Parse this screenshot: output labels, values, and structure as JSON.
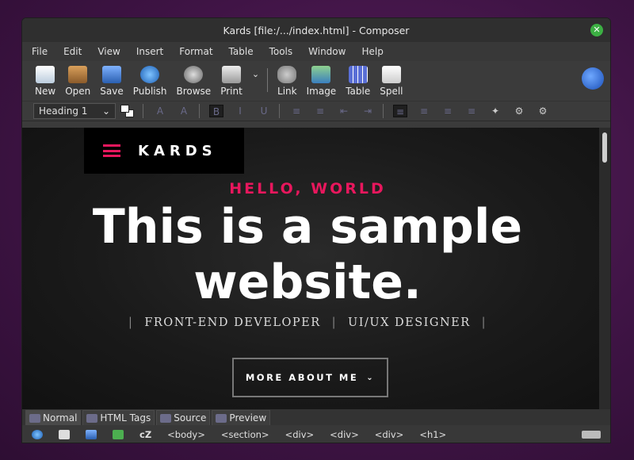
{
  "window": {
    "title": "Kards [file:/.../index.html] - Composer"
  },
  "menu": [
    "File",
    "Edit",
    "View",
    "Insert",
    "Format",
    "Table",
    "Tools",
    "Window",
    "Help"
  ],
  "toolbar": {
    "new": "New",
    "open": "Open",
    "save": "Save",
    "publish": "Publish",
    "browse": "Browse",
    "print": "Print",
    "link": "Link",
    "image": "Image",
    "table": "Table",
    "spell": "Spell"
  },
  "format": {
    "paragraph_style": "Heading 1"
  },
  "page": {
    "brand": "KARDS",
    "kicker": "HELLO, WORLD",
    "headline_line1": "This is a sample",
    "headline_line2": "website.",
    "role1": "FRONT-END DEVELOPER",
    "role2": "UI/UX DESIGNER",
    "button": "MORE ABOUT ME"
  },
  "tabs": [
    "Normal",
    "HTML Tags",
    "Source",
    "Preview"
  ],
  "status": {
    "cz": "cZ",
    "breadcrumbs": [
      "<body>",
      "<section>",
      "<div>",
      "<div>",
      "<div>",
      "<h1>"
    ]
  },
  "colors": {
    "accent": "#e8175d",
    "close": "#3cb043"
  }
}
